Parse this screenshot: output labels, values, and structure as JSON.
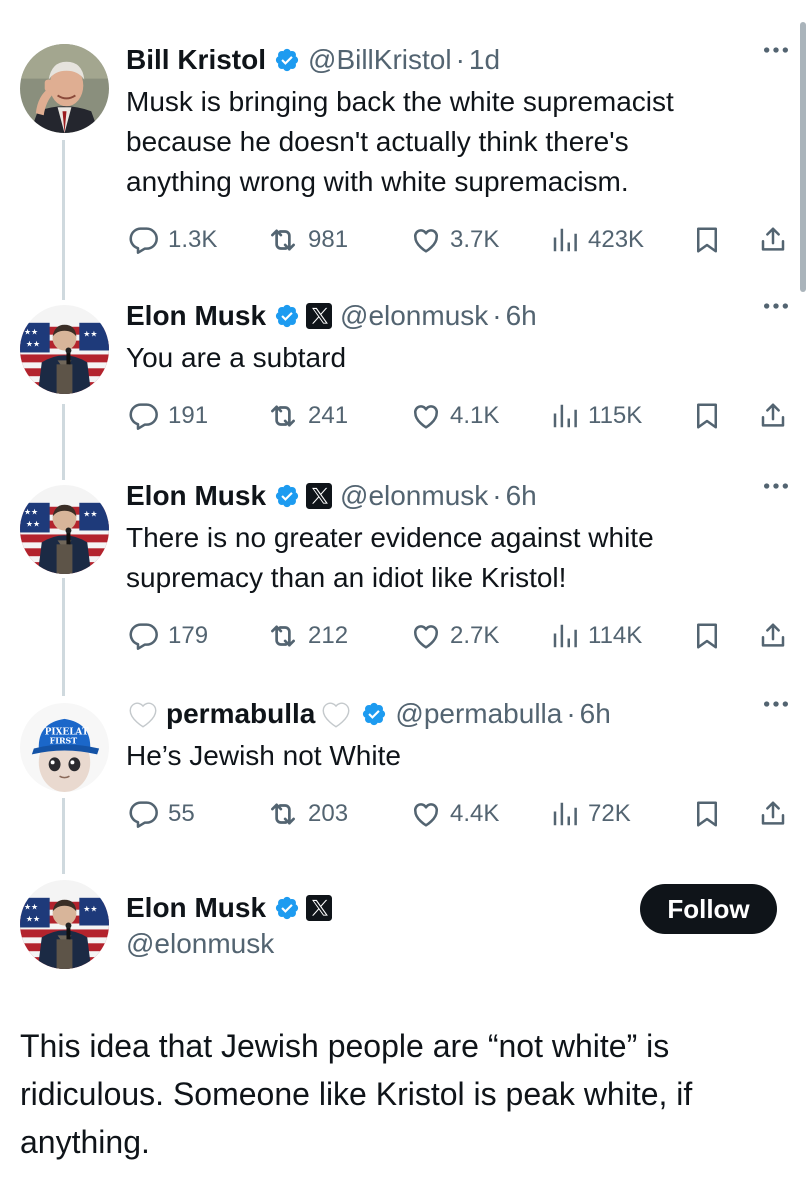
{
  "colors": {
    "verified": "#1d9bf0",
    "text": "#0f1419",
    "secondary": "#536471",
    "thread_line": "#cfd9de"
  },
  "icons": {
    "verified": "verified-icon",
    "x_badge": "x-logo-icon",
    "more": "more-icon",
    "reply": "reply-icon",
    "repost": "repost-icon",
    "like": "like-icon",
    "views": "views-icon",
    "bookmark": "bookmark-icon",
    "share": "share-icon",
    "heart_emoji": "white-heart-icon"
  },
  "posts": [
    {
      "name": "Bill Kristol",
      "handle": "@BillKristol",
      "dot": "·",
      "time": "1d",
      "text_lines": [
        "Musk is bringing back the white supremacist",
        "because he doesn't actually think there's",
        "anything wrong with white supremacism."
      ],
      "replies": "1.3K",
      "reposts": "981",
      "likes": "3.7K",
      "views": "423K"
    },
    {
      "name": "Elon Musk",
      "handle": "@elonmusk",
      "dot": "·",
      "time": "6h",
      "text_lines": [
        "You are a subtard"
      ],
      "replies": "191",
      "reposts": "241",
      "likes": "4.1K",
      "views": "115K"
    },
    {
      "name": "Elon Musk",
      "handle": "@elonmusk",
      "dot": "·",
      "time": "6h",
      "text_lines": [
        "There is no greater evidence against white",
        "supremacy than an idiot like Kristol!"
      ],
      "replies": "179",
      "reposts": "212",
      "likes": "2.7K",
      "views": "114K"
    },
    {
      "name": "permabulla",
      "handle": "@permabulla",
      "dot": "·",
      "time": "6h",
      "text_lines": [
        "He’s Jewish not White"
      ],
      "replies": "55",
      "reposts": "203",
      "likes": "4.4K",
      "views": "72K"
    }
  ],
  "main_post": {
    "name": "Elon Musk",
    "handle": "@elonmusk",
    "follow_label": "Follow",
    "text_lines": [
      "This idea that Jewish people are “not white” is",
      "ridiculous. Someone like Kristol is peak white, if",
      "anything."
    ]
  },
  "avatar_texts": {
    "cap_line1": "PIXELATED",
    "cap_line2": "FIRST"
  }
}
